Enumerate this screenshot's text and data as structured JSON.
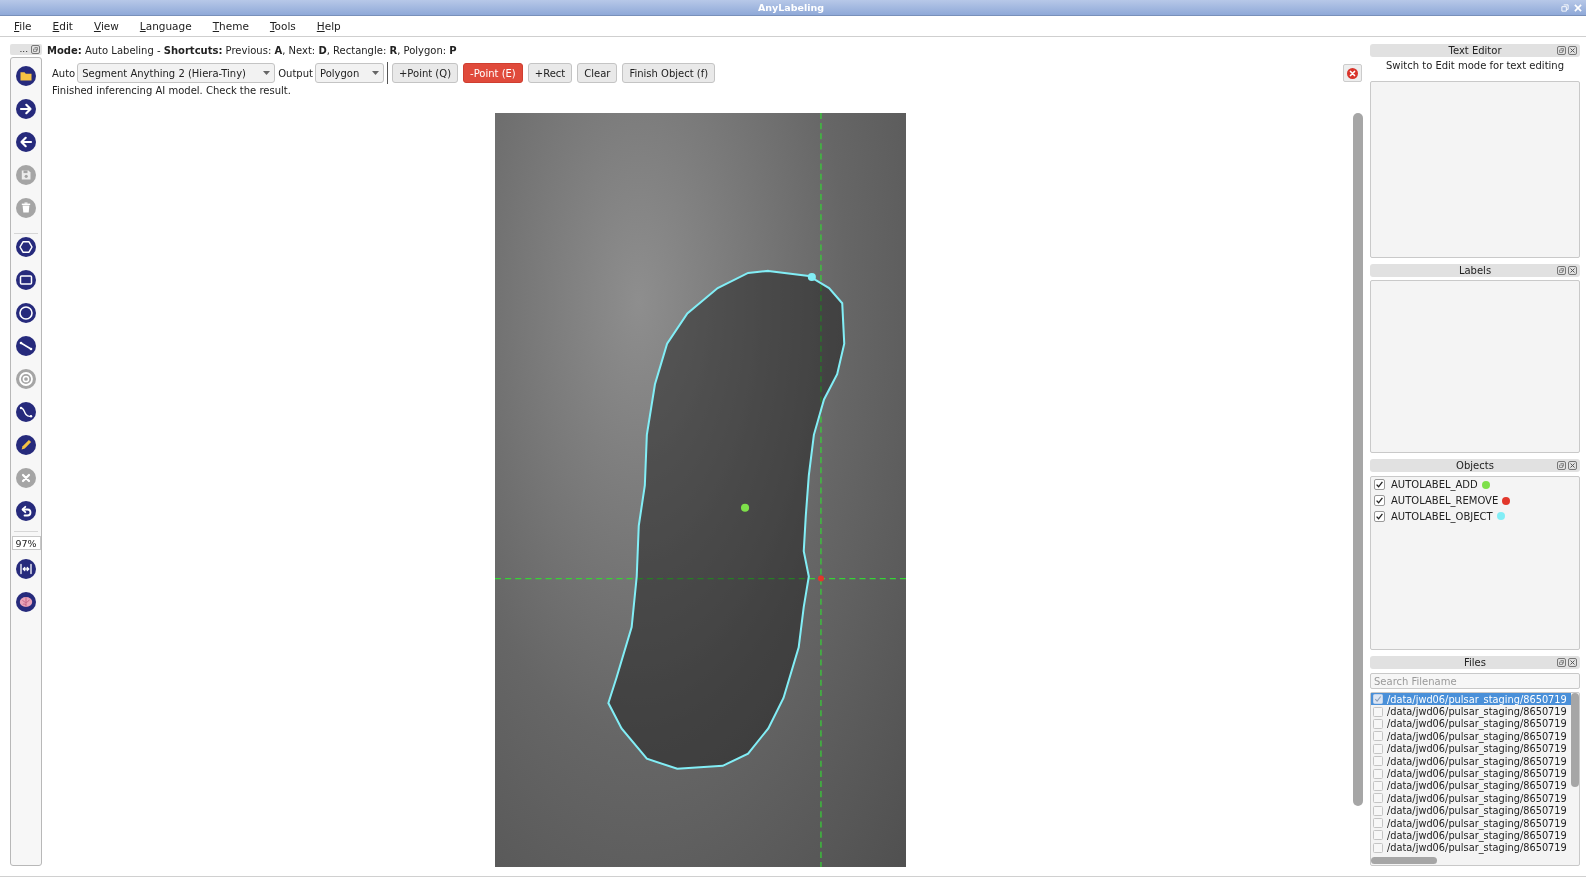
{
  "window": {
    "title": "AnyLabeling"
  },
  "menu": [
    "File",
    "Edit",
    "View",
    "Language",
    "Theme",
    "Tools",
    "Help"
  ],
  "left_toolbar": {
    "handle": "...",
    "groups": [
      [
        {
          "disabled": false
        },
        {
          "disabled": false
        },
        {
          "disabled": false
        },
        {
          "disabled": true
        },
        {
          "disabled": true
        }
      ],
      [
        {
          "disabled": false
        },
        {
          "disabled": false
        },
        {
          "disabled": false
        },
        {
          "disabled": false
        },
        {
          "disabled": true
        },
        {
          "disabled": false
        },
        {
          "disabled": false
        },
        {
          "disabled": true
        },
        {
          "disabled": false
        }
      ]
    ],
    "zoom": "97%",
    "zoom_tools": [
      {
        "disabled": false
      },
      {
        "disabled": false
      }
    ]
  },
  "mode_line": "**Mode:** Auto Labeling - **Shortcuts:** Previous: **A**, Next: **D**, Rectangle: **R**, Polygon: **P**",
  "auto_toolbar": {
    "auto_label": "Auto",
    "model": "Segment Anything 2 (Hiera-Tiny)",
    "output_label": "Output",
    "output": "Polygon",
    "buttons": [
      {
        "label": "+Point (Q)",
        "selected": false
      },
      {
        "label": "-Point (E)",
        "selected": true
      },
      {
        "label": "+Rect",
        "selected": false
      },
      {
        "label": "Clear",
        "selected": false
      },
      {
        "label": "Finish Object (f)",
        "selected": false
      }
    ]
  },
  "status": "Finished inferencing AI model. Check the result.",
  "text_editor": {
    "title": "Text Editor",
    "hint": "Switch to Edit mode for text editing"
  },
  "labels": {
    "title": "Labels"
  },
  "objects": {
    "title": "Objects",
    "items": [
      {
        "label": "AUTOLABEL_ADD",
        "checked": true,
        "color": "#7ee04a"
      },
      {
        "label": "AUTOLABEL_REMOVE",
        "checked": true,
        "color": "#e2372b"
      },
      {
        "label": "AUTOLABEL_OBJECT",
        "checked": true,
        "color": "#82eef6"
      }
    ]
  },
  "files": {
    "title": "Files",
    "search": {
      "placeholder": "Search Filename"
    },
    "items": [
      {
        "path": "/data/jwd06/pulsar_staging/8650719",
        "checked": true,
        "selected": true
      },
      {
        "path": "/data/jwd06/pulsar_staging/8650719",
        "checked": false,
        "selected": false
      },
      {
        "path": "/data/jwd06/pulsar_staging/8650719",
        "checked": false,
        "selected": false
      },
      {
        "path": "/data/jwd06/pulsar_staging/8650719",
        "checked": false,
        "selected": false
      },
      {
        "path": "/data/jwd06/pulsar_staging/8650719",
        "checked": false,
        "selected": false
      },
      {
        "path": "/data/jwd06/pulsar_staging/8650719",
        "checked": false,
        "selected": false
      },
      {
        "path": "/data/jwd06/pulsar_staging/8650719",
        "checked": false,
        "selected": false
      },
      {
        "path": "/data/jwd06/pulsar_staging/8650719",
        "checked": false,
        "selected": false
      },
      {
        "path": "/data/jwd06/pulsar_staging/8650719",
        "checked": false,
        "selected": false
      },
      {
        "path": "/data/jwd06/pulsar_staging/8650719",
        "checked": false,
        "selected": false
      },
      {
        "path": "/data/jwd06/pulsar_staging/8650719",
        "checked": false,
        "selected": false
      },
      {
        "path": "/data/jwd06/pulsar_staging/8650719",
        "checked": false,
        "selected": false
      },
      {
        "path": "/data/jwd06/pulsar_staging/8650719",
        "checked": false,
        "selected": false
      }
    ]
  }
}
